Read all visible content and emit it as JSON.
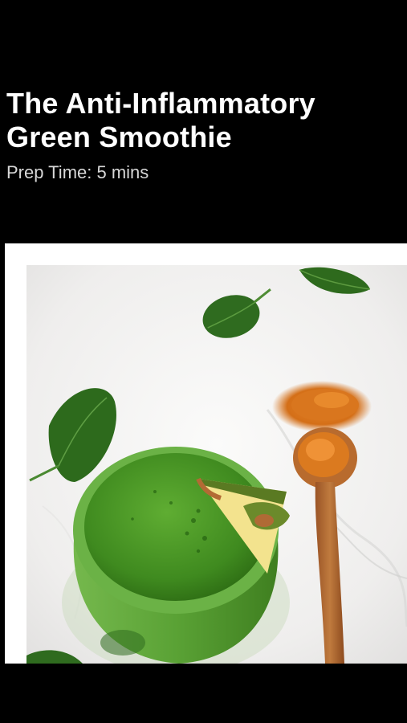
{
  "recipe": {
    "title": "The Anti-Inflammatory Green Smoothie",
    "prep_time": "Prep Time: 5 mins"
  },
  "photo": {
    "icon": "smoothie-photo",
    "colors": {
      "smoothie": "#4f9a2b",
      "smoothie_dark": "#2f6e16",
      "spinach": "#2f6a1f",
      "turmeric": "#d9781e",
      "spoon": "#b46a33",
      "pineapple": "#f2e08a",
      "marble": "#f0efee"
    }
  }
}
